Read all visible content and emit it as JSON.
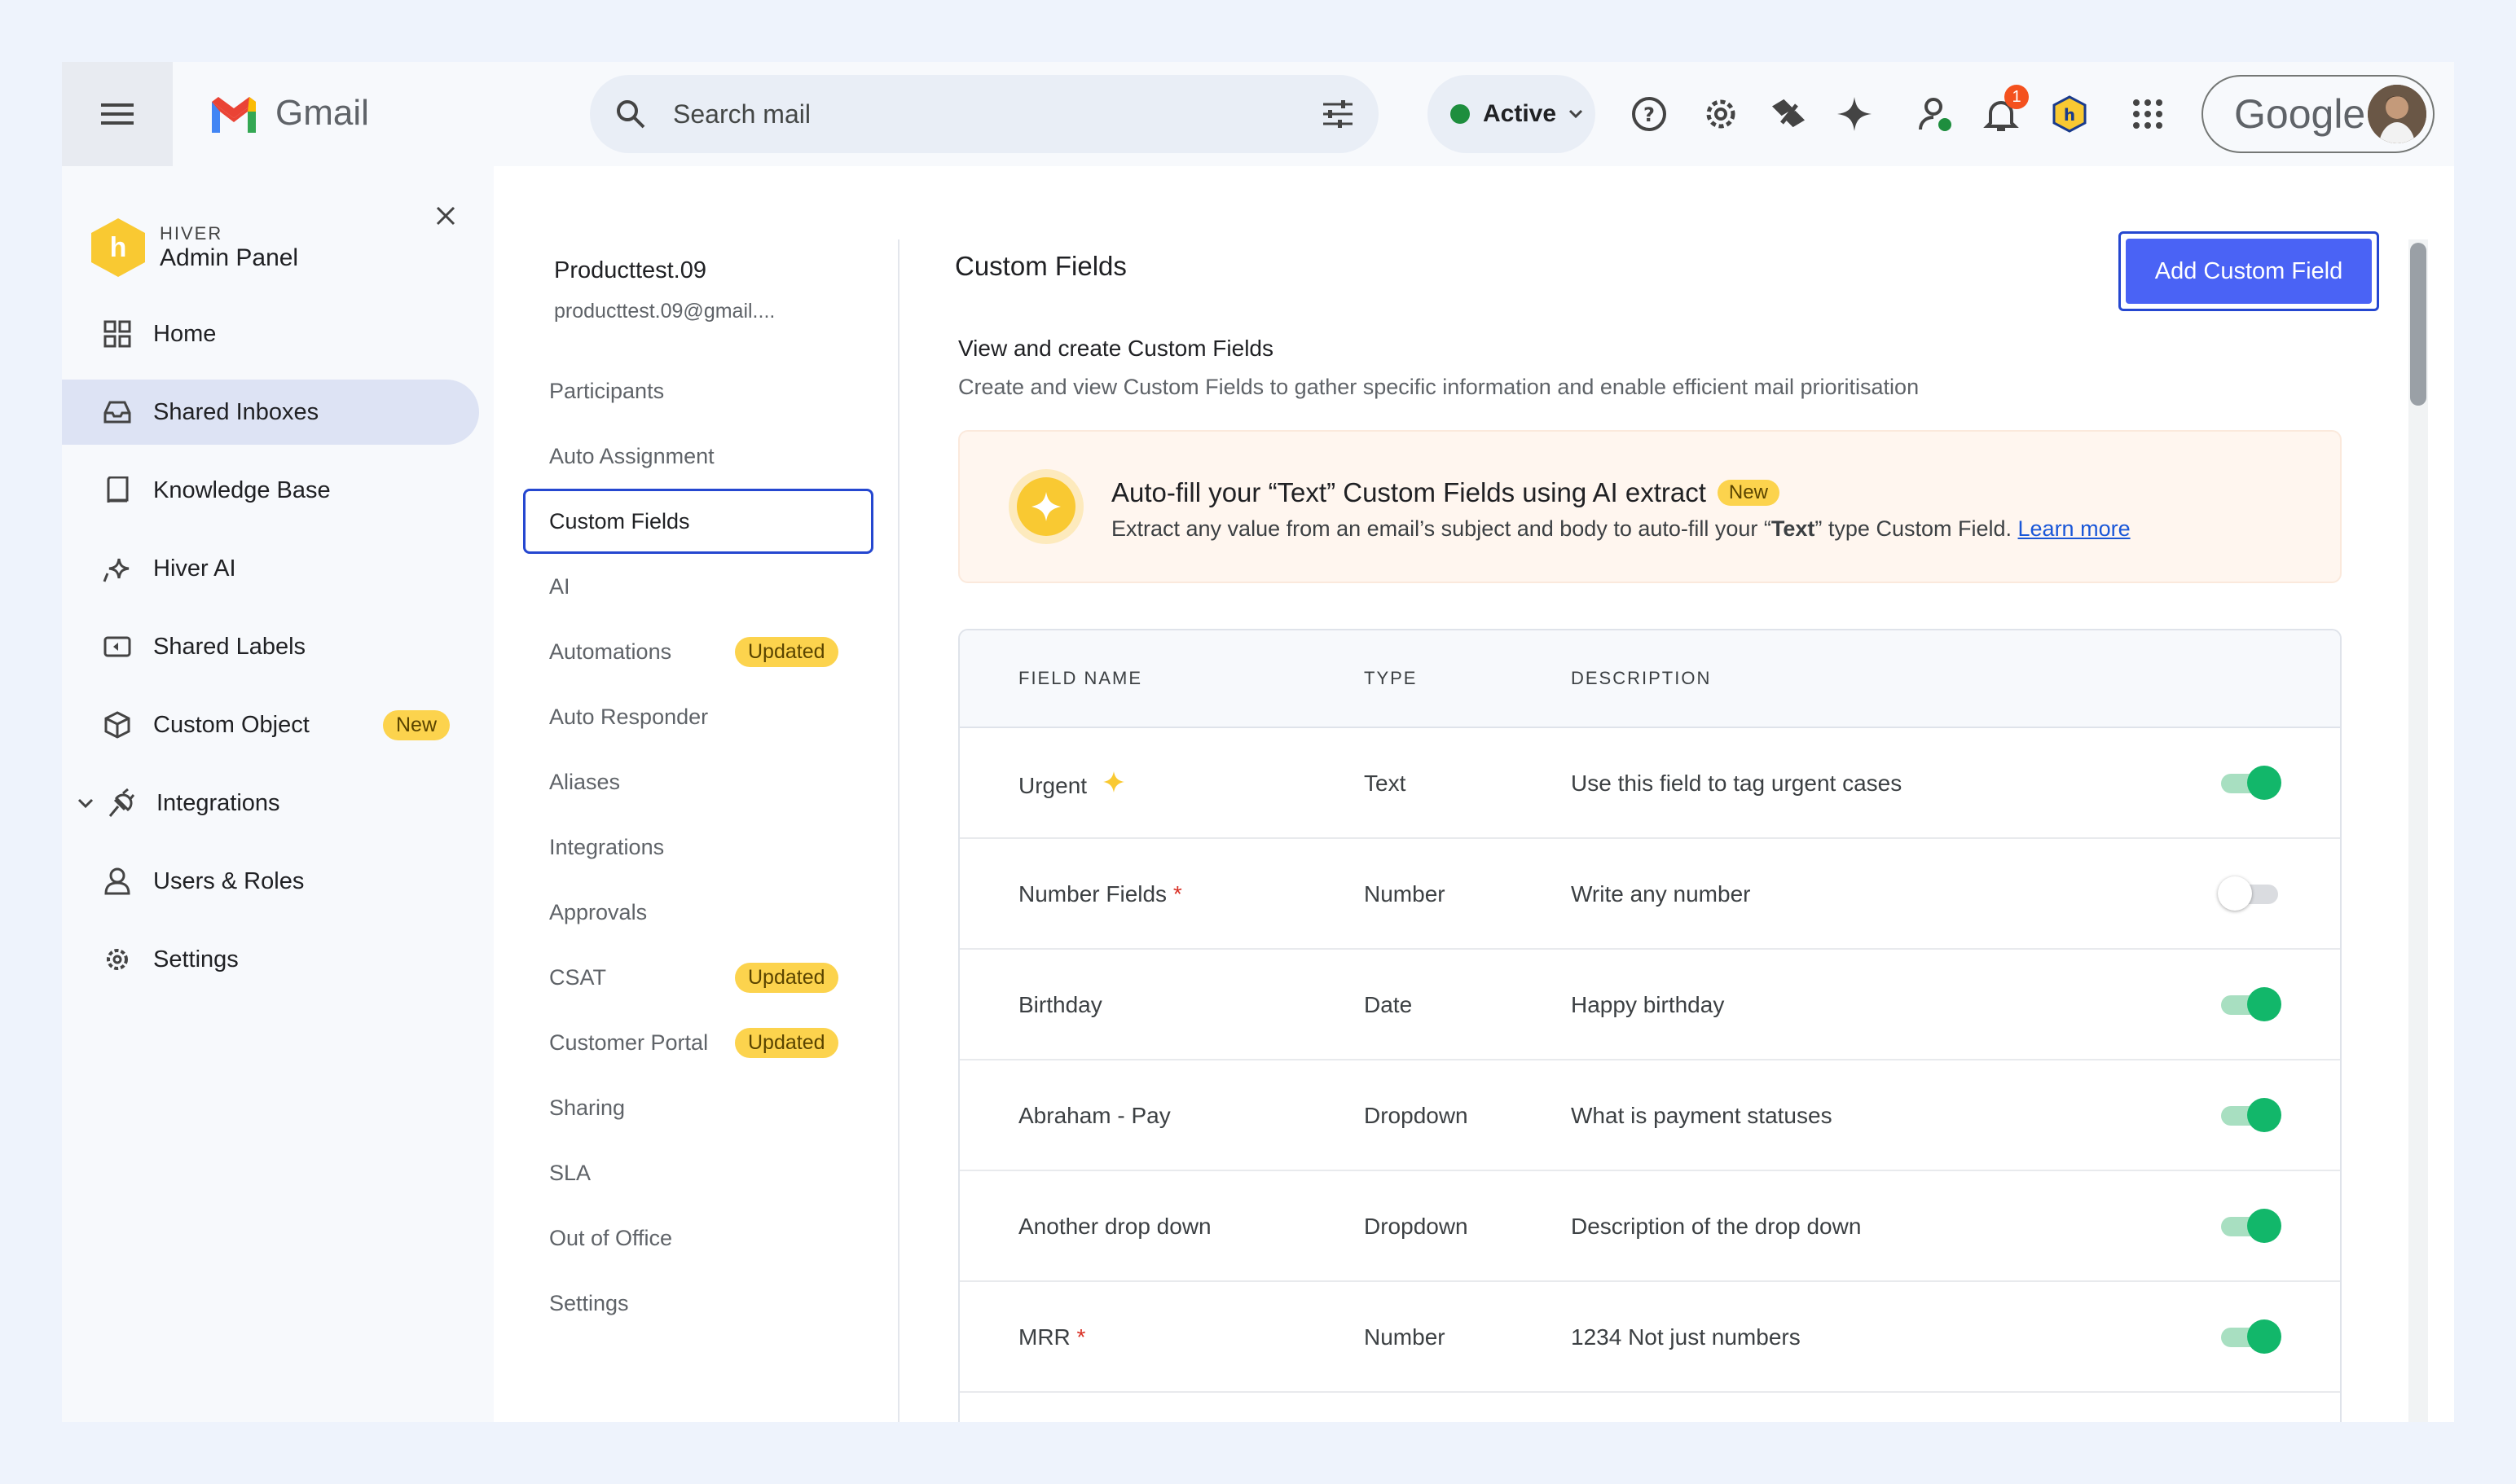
{
  "topbar": {
    "app_name": "Gmail",
    "search_placeholder": "Search mail",
    "status": "Active",
    "notification_count": "1",
    "account_brand": "Google"
  },
  "sidebar": {
    "brand": "HIVER",
    "title": "Admin Panel",
    "items": [
      {
        "label": "Home"
      },
      {
        "label": "Shared Inboxes"
      },
      {
        "label": "Knowledge Base"
      },
      {
        "label": "Hiver AI"
      },
      {
        "label": "Shared Labels"
      },
      {
        "label": "Custom Object",
        "tag": "New"
      },
      {
        "label": "Integrations"
      },
      {
        "label": "Users & Roles"
      },
      {
        "label": "Settings"
      }
    ]
  },
  "subnav": {
    "account_name": "Producttest.09",
    "account_email": "producttest.09@gmail....",
    "items": [
      {
        "label": "Participants"
      },
      {
        "label": "Auto Assignment"
      },
      {
        "label": "Custom Fields"
      },
      {
        "label": "AI"
      },
      {
        "label": "Automations",
        "tag": "Updated"
      },
      {
        "label": "Auto Responder"
      },
      {
        "label": "Aliases"
      },
      {
        "label": "Integrations"
      },
      {
        "label": "Approvals"
      },
      {
        "label": "CSAT",
        "tag": "Updated"
      },
      {
        "label": "Customer Portal",
        "tag": "Updated"
      },
      {
        "label": "Sharing"
      },
      {
        "label": "SLA"
      },
      {
        "label": "Out of Office"
      },
      {
        "label": "Settings"
      }
    ]
  },
  "main": {
    "title": "Custom Fields",
    "add_button": "Add Custom Field",
    "section_title": "View and create Custom Fields",
    "section_desc": "Create and view Custom Fields to gather specific information and enable efficient mail prioritisation",
    "banner": {
      "title": "Auto-fill your “Text” Custom Fields using AI extract",
      "tag": "New",
      "text_before": "Extract any value from an email’s subject and body to auto-fill your “",
      "text_bold": "Text",
      "text_after": "” type Custom Field.",
      "link": "Learn more"
    },
    "table": {
      "headers": {
        "name": "FIELD NAME",
        "type": "TYPE",
        "desc": "DESCRIPTION"
      },
      "rows": [
        {
          "name": "Urgent",
          "type": "Text",
          "desc": "Use this field to tag urgent cases",
          "enabled": true,
          "ai": true,
          "required": false
        },
        {
          "name": "Number Fields",
          "type": "Number",
          "desc": "Write any number",
          "enabled": false,
          "ai": false,
          "required": true
        },
        {
          "name": "Birthday",
          "type": "Date",
          "desc": "Happy birthday",
          "enabled": true,
          "ai": false,
          "required": false
        },
        {
          "name": "Abraham - Pay",
          "type": "Dropdown",
          "desc": "What is payment statuses",
          "enabled": true,
          "ai": false,
          "required": false
        },
        {
          "name": "Another drop down",
          "type": "Dropdown",
          "desc": "Description of the drop down",
          "enabled": true,
          "ai": false,
          "required": false
        },
        {
          "name": "MRR",
          "type": "Number",
          "desc": "1234 Not just numbers",
          "enabled": true,
          "ai": false,
          "required": true
        }
      ]
    }
  },
  "colors": {
    "accent": "#4a63f5",
    "toggle_on": "#12b76a",
    "tag_bg": "#fcd34d"
  }
}
